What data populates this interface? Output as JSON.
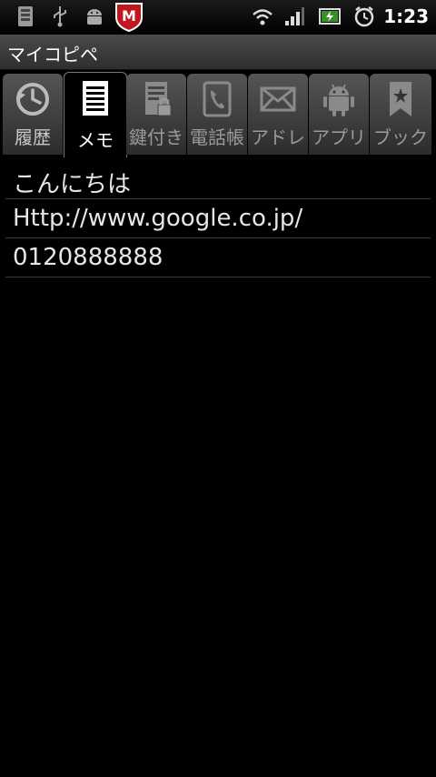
{
  "status_bar": {
    "time": "1:23",
    "icons": [
      "sd-card-icon",
      "usb-icon",
      "android-debug-icon",
      "mcafee-icon",
      "wifi-icon",
      "signal-icon",
      "battery-charging-icon",
      "alarm-clock-icon"
    ]
  },
  "app": {
    "title": "マイコピペ"
  },
  "tabs": [
    {
      "label": "履歴",
      "icon": "history-icon"
    },
    {
      "label": "メモ",
      "icon": "memo-icon",
      "selected": true
    },
    {
      "label": "鍵付き",
      "icon": "locked-memo-icon"
    },
    {
      "label": "電話帳",
      "icon": "phonebook-icon"
    },
    {
      "label": "アドレ",
      "icon": "mail-icon"
    },
    {
      "label": "アプリ",
      "icon": "android-app-icon"
    },
    {
      "label": "ブック",
      "icon": "bookmark-icon"
    }
  ],
  "memo_items": [
    "こんにちは",
    "Http://www.google.co.jp/",
    "0120888888"
  ],
  "colors": {
    "background": "#000000",
    "text": "#e6e6e6",
    "mcafee_red": "#c0161d"
  }
}
